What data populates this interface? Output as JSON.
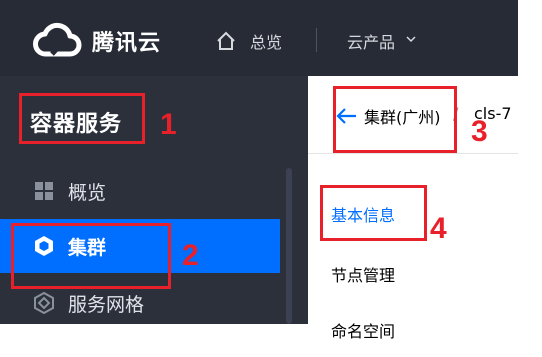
{
  "topbar": {
    "brand": "腾讯云",
    "overview": "总览",
    "products": "云产品"
  },
  "sidebar": {
    "title": "容器服务",
    "items": [
      {
        "label": "概览",
        "icon": "grid-icon"
      },
      {
        "label": "集群",
        "icon": "cluster-icon"
      },
      {
        "label": "服务网格",
        "icon": "mesh-icon"
      }
    ]
  },
  "main": {
    "breadcrumb": {
      "cluster": "集群(广州)",
      "separator": "/",
      "cluster_id": "cls-7"
    },
    "tabs": [
      {
        "label": "基本信息"
      },
      {
        "label": "节点管理"
      },
      {
        "label": "命名空间"
      }
    ]
  },
  "annotations": [
    "1",
    "2",
    "3",
    "4"
  ],
  "colors": {
    "topbar_bg": "#262b36",
    "sidebar_bg": "#2b303b",
    "accent": "#006eff",
    "annotation": "#e8202a"
  }
}
